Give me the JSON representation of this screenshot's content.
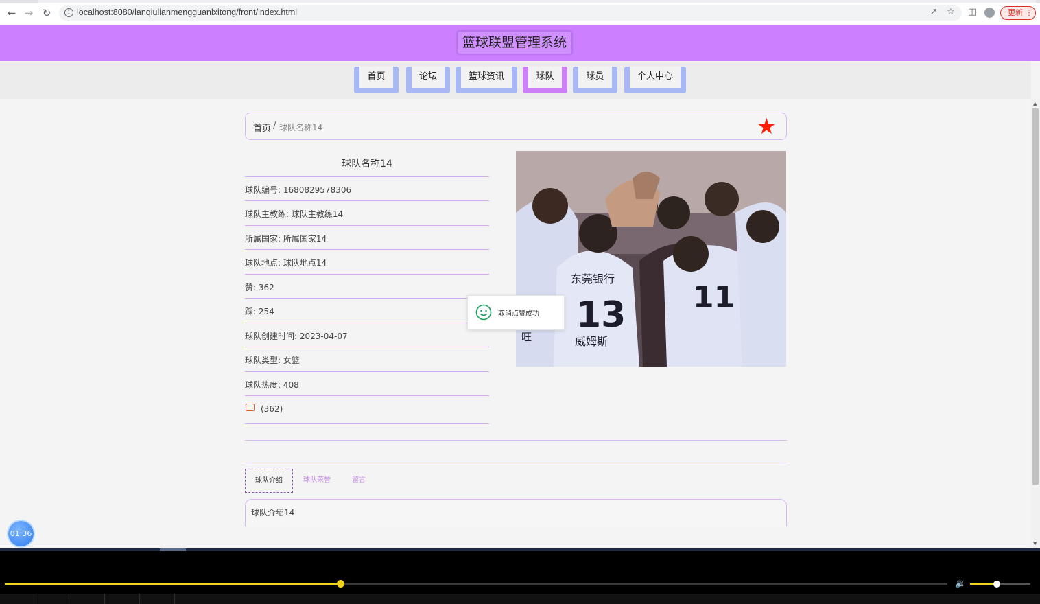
{
  "browser": {
    "url": "localhost:8080/lanqiulianmengguanlxitong/front/index.html",
    "update_label": "更新"
  },
  "site": {
    "title": "篮球联盟管理系统",
    "nav": [
      "首页",
      "论坛",
      "篮球资讯",
      "球队",
      "球员",
      "个人中心"
    ],
    "active_nav": "球队"
  },
  "breadcrumb": {
    "home": "首页",
    "separator": "/",
    "current": "球队名称14"
  },
  "team": {
    "name": "球队名称14",
    "fields": [
      "球队编号: 1680829578306",
      "球队主教练: 球队主教练14",
      "所属国家: 所属国家14",
      "球队地点: 球队地点14",
      "赞: 362",
      "踩: 254",
      "球队创建时间: 2023-04-07",
      "球队类型: 女篮",
      "球队热度: 408"
    ],
    "like_count": "(362)",
    "photo_jersey_text": [
      "东莞银行",
      "13",
      "威姆斯",
      "11",
      "旺"
    ]
  },
  "toast": {
    "message": "取消点赞成功"
  },
  "tabs": [
    "球队介绍",
    "球队荣誉",
    "留言"
  ],
  "active_tab": "球队介绍",
  "intro_text": "球队介绍14",
  "timer": "01:36",
  "player": {
    "progress": 0.356,
    "volume": 0.44
  },
  "colors": {
    "header": "#cc80ff",
    "nav_border": "#a7b8f5",
    "nav_active": "#cc7ff7",
    "star": "#ff1a00",
    "accent_line": "#d4aaf0",
    "player_accent": "#f2d31b"
  }
}
